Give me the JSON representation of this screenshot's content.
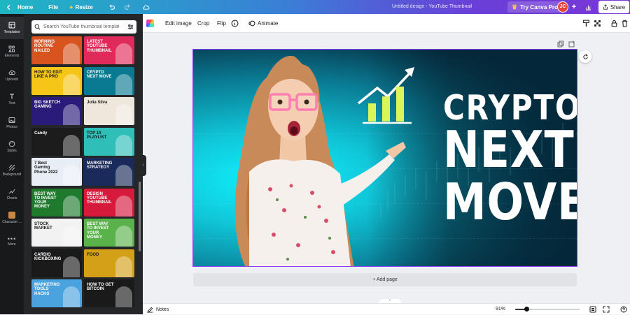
{
  "topbar": {
    "home_label": "Home",
    "file_label": "File",
    "resize_label": "Resize",
    "title": "Untitled design - YouTube Thumbnail",
    "try_pro_label": "Try Canva Pro",
    "avatar_initials": "JC",
    "plus_label": "+",
    "share_label": "Share"
  },
  "rail": {
    "items": [
      {
        "label": "Templates",
        "icon": "templates-icon"
      },
      {
        "label": "Elements",
        "icon": "elements-icon"
      },
      {
        "label": "Uploads",
        "icon": "upload-icon"
      },
      {
        "label": "Text",
        "icon": "text-icon"
      },
      {
        "label": "Photos",
        "icon": "photos-icon"
      },
      {
        "label": "Styles",
        "icon": "styles-icon"
      },
      {
        "label": "Background",
        "icon": "background-icon"
      },
      {
        "label": "Charts",
        "icon": "charts-icon"
      },
      {
        "label": "Character ...",
        "icon": "character-icon"
      },
      {
        "label": "More",
        "icon": "more-icon"
      }
    ]
  },
  "panel": {
    "search_placeholder": "Search YouTube thumbnail templates",
    "templates": [
      {
        "text": "MORNING ROUTINE NAILED",
        "bg": "#d9531e"
      },
      {
        "text": "LATEST YOUTUBE THUMBNAIL",
        "bg": "#e02b5a"
      },
      {
        "text": "HOW TO EDIT LIKE A PRO",
        "bg": "#f5c518"
      },
      {
        "text": "CRYPTO NEXT MOVE",
        "bg": "#0a7a93"
      },
      {
        "text": "BIG SKETCH GAMING",
        "bg": "#2a1a7a"
      },
      {
        "text": "Julia Silva",
        "bg": "#efe6dc"
      },
      {
        "text": "Candy",
        "bg": "#1c1c1c"
      },
      {
        "text": "TOP 10 PLAYLIST",
        "bg": "#2fbfb8"
      },
      {
        "text": "7 Best Gaming Phone 2022",
        "bg": "#e9edf5"
      },
      {
        "text": "MARKETING STRATEGY",
        "bg": "#1a2a5a"
      },
      {
        "text": "BEST WAY TO INVEST YOUR MONEY",
        "bg": "#1f7a2e"
      },
      {
        "text": "DESIGN YOUTUBE THUMBNAIL",
        "bg": "#d61a3c"
      },
      {
        "text": "STOCK MARKET",
        "bg": "#f2f2f2"
      },
      {
        "text": "BEST WAY TO INVEST YOUR MONEY",
        "bg": "#5ab24a"
      },
      {
        "text": "CARDIO KICKBOXING",
        "bg": "#1a1a1a"
      },
      {
        "text": "FOOD",
        "bg": "#d4a017"
      },
      {
        "text": "MARKETING TOOLS HACKS",
        "bg": "#4aa3df"
      },
      {
        "text": "HOW TO GET BITCOIN",
        "bg": "#1a1a1a"
      }
    ]
  },
  "toolbar": {
    "edit_image_label": "Edit image",
    "crop_label": "Crop",
    "flip_label": "Flip",
    "animate_label": "Animate"
  },
  "canvas": {
    "headline_1": "CRYPTO",
    "headline_2": "NEXT",
    "headline_3": "MOVE",
    "add_page_label": "+ Add page"
  },
  "bottombar": {
    "notes_label": "Notes",
    "zoom_label": "91%",
    "zoom_value": 0.18
  }
}
